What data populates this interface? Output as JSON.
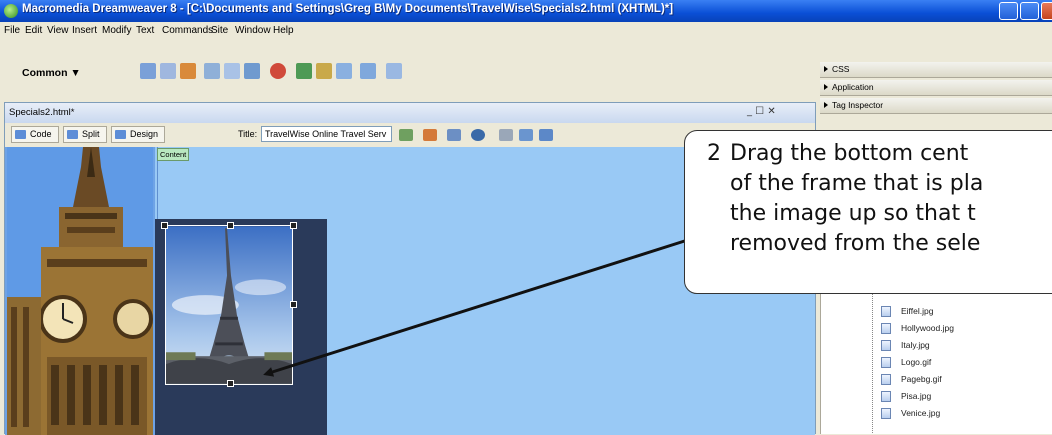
{
  "window": {
    "title": "Macromedia Dreamweaver 8 - [C:\\Documents and Settings\\Greg B\\My Documents\\TravelWise\\Specials2.html (XHTML)*]"
  },
  "menu": [
    "File",
    "Edit",
    "View",
    "Insert",
    "Modify",
    "Text",
    "Commands",
    "Site",
    "Window",
    "Help"
  ],
  "insert_bar": {
    "category": "Common ▼"
  },
  "document": {
    "tab_label": "Specials2.html*",
    "window_controls": "_ ☐ ✕",
    "buttons": {
      "code": "Code",
      "split": "Split",
      "design": "Design"
    },
    "title_label": "Title:",
    "title_value": "TravelWise Online Travel Serv",
    "content_label": "Content"
  },
  "panels": {
    "headers": [
      "CSS",
      "Application",
      "Tag Inspector"
    ],
    "files": [
      "Eiffel.jpg",
      "Hollywood.jpg",
      "Italy.jpg",
      "Logo.gif",
      "Pagebg.gif",
      "Pisa.jpg",
      "Venice.jpg"
    ]
  },
  "callout": {
    "number": "2",
    "lines": [
      "Drag the bottom cent",
      "of the frame that is pla",
      "the image up so that t",
      "removed from the sele"
    ]
  },
  "colors": {
    "title_bar": "#0a4fd6",
    "design_bg": "#99c9f5",
    "chrome": "#ece9d8"
  }
}
